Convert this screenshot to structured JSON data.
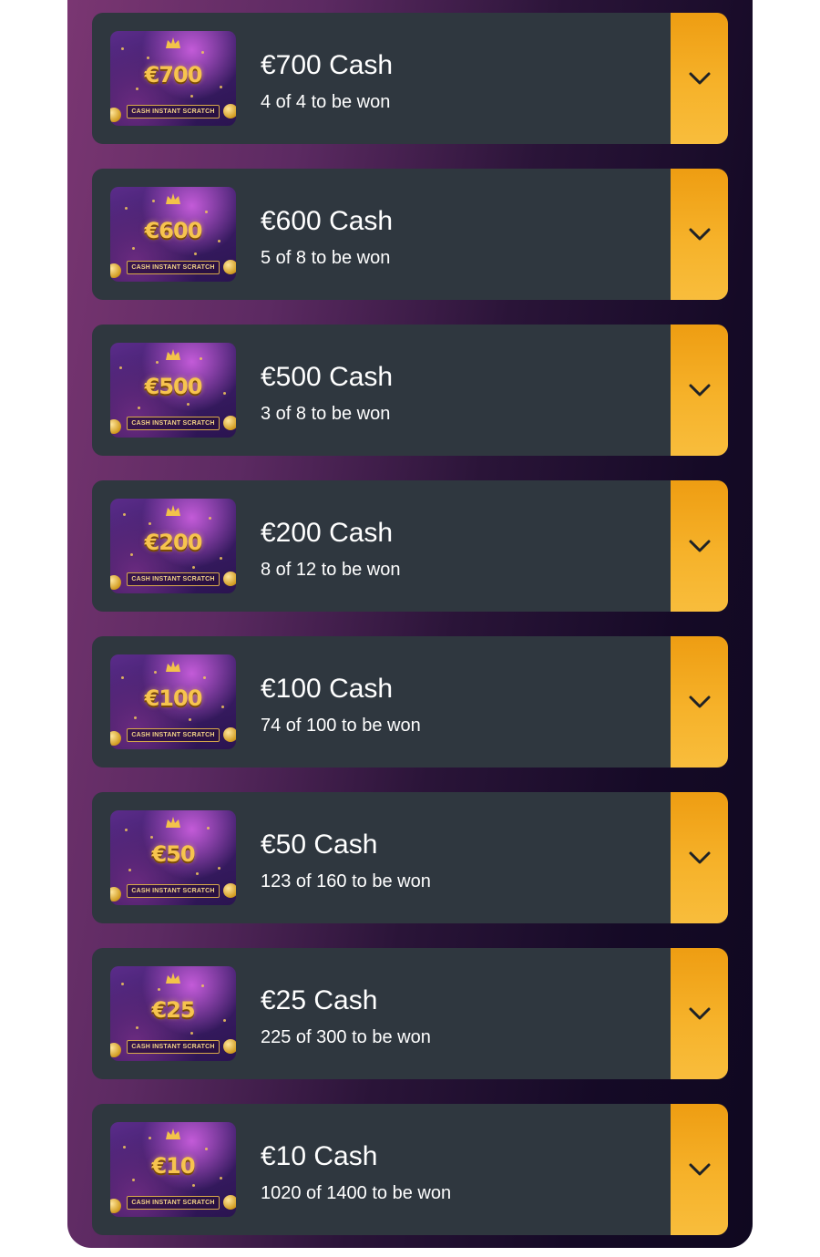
{
  "prizes": [
    {
      "title": "€700 Cash",
      "subtitle": "4 of 4 to be won",
      "thumb_amount": "€700",
      "thumb_label": "CASH INSTANT SCRATCH"
    },
    {
      "title": "€600 Cash",
      "subtitle": "5 of 8 to be won",
      "thumb_amount": "€600",
      "thumb_label": "CASH INSTANT SCRATCH"
    },
    {
      "title": "€500 Cash",
      "subtitle": "3 of 8 to be won",
      "thumb_amount": "€500",
      "thumb_label": "CASH INSTANT SCRATCH"
    },
    {
      "title": "€200 Cash",
      "subtitle": "8 of 12 to be won",
      "thumb_amount": "€200",
      "thumb_label": "CASH INSTANT SCRATCH"
    },
    {
      "title": "€100 Cash",
      "subtitle": "74 of 100 to be won",
      "thumb_amount": "€100",
      "thumb_label": "CASH INSTANT SCRATCH"
    },
    {
      "title": "€50 Cash",
      "subtitle": "123 of 160 to be won",
      "thumb_amount": "€50",
      "thumb_label": "CASH INSTANT SCRATCH"
    },
    {
      "title": "€25 Cash",
      "subtitle": "225 of 300 to be won",
      "thumb_amount": "€25",
      "thumb_label": "CASH INSTANT SCRATCH"
    },
    {
      "title": "€10 Cash",
      "subtitle": "1020 of 1400 to be won",
      "thumb_amount": "€10",
      "thumb_label": "CASH INSTANT SCRATCH"
    }
  ],
  "icons": {
    "expand": "chevron-down-icon",
    "crown": "crown-icon",
    "coin": "coin-icon"
  },
  "colors": {
    "card": "#2f373f",
    "accent": "#f6b22a",
    "text": "#ffffff",
    "thumb_amount": "#f7c44e"
  }
}
